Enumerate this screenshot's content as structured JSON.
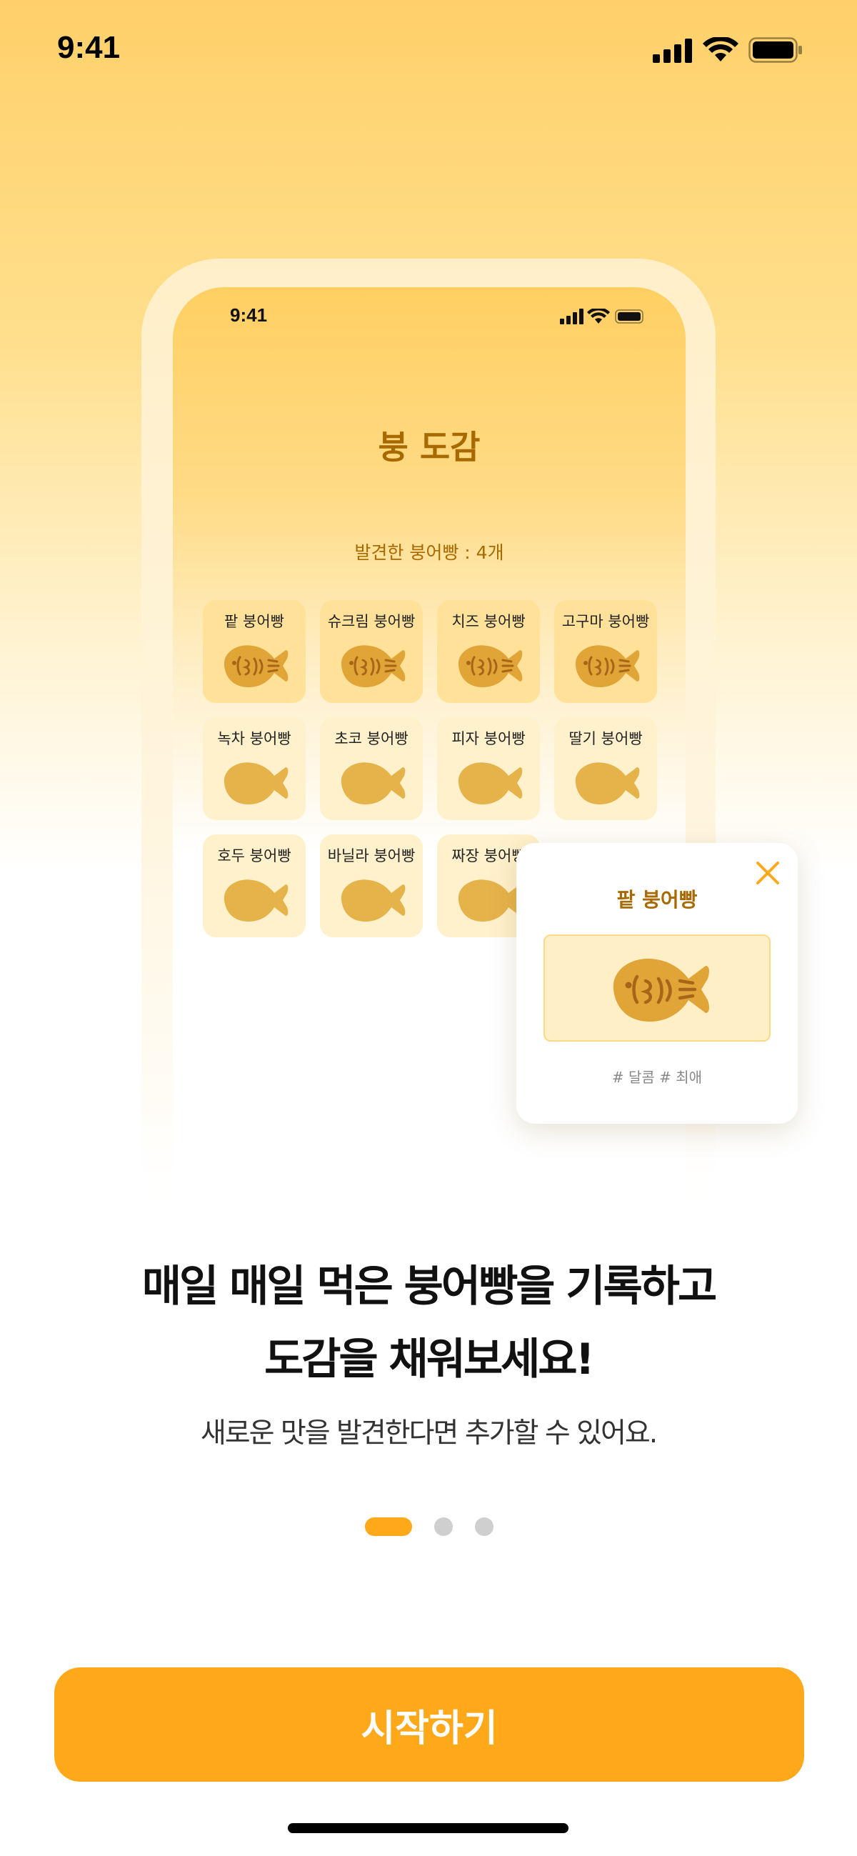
{
  "status_bar": {
    "time": "9:41",
    "icons": [
      "signal-icon",
      "wifi-icon",
      "battery-icon"
    ]
  },
  "mockup": {
    "status_time": "9:41",
    "title": "붕 도감",
    "count_text": "발견한 붕어빵 : 4개",
    "items": [
      {
        "label": "팥 붕어빵",
        "found": true
      },
      {
        "label": "슈크림 붕어빵",
        "found": true
      },
      {
        "label": "치즈 붕어빵",
        "found": true
      },
      {
        "label": "고구마 붕어빵",
        "found": true
      },
      {
        "label": "녹차 붕어빵",
        "found": false
      },
      {
        "label": "초코 붕어빵",
        "found": false
      },
      {
        "label": "피자 붕어빵",
        "found": false
      },
      {
        "label": "딸기 붕어빵",
        "found": false
      },
      {
        "label": "호두 붕어빵",
        "found": false
      },
      {
        "label": "바닐라 붕어빵",
        "found": false
      },
      {
        "label": "짜장 붕어빵",
        "found": false
      }
    ]
  },
  "popup": {
    "title": "팥 붕어빵",
    "tags": "# 달콤 # 최애",
    "close_icon": "close-icon"
  },
  "onboarding": {
    "headline_line1": "매일 매일 먹은 붕어빵을 기록하고",
    "headline_line2": "도감을 채워보세요!",
    "subtext": "새로운 맛을 발견한다면 추가할 수 있어요.",
    "page_index": 1,
    "page_count": 3
  },
  "cta": {
    "label": "시작하기"
  },
  "colors": {
    "accent": "#ffa91a",
    "brown_text": "#a86a00",
    "fish_fill": "#e6b24a",
    "fish_found_fill": "#e0a536",
    "fish_pattern": "#a8651a"
  }
}
